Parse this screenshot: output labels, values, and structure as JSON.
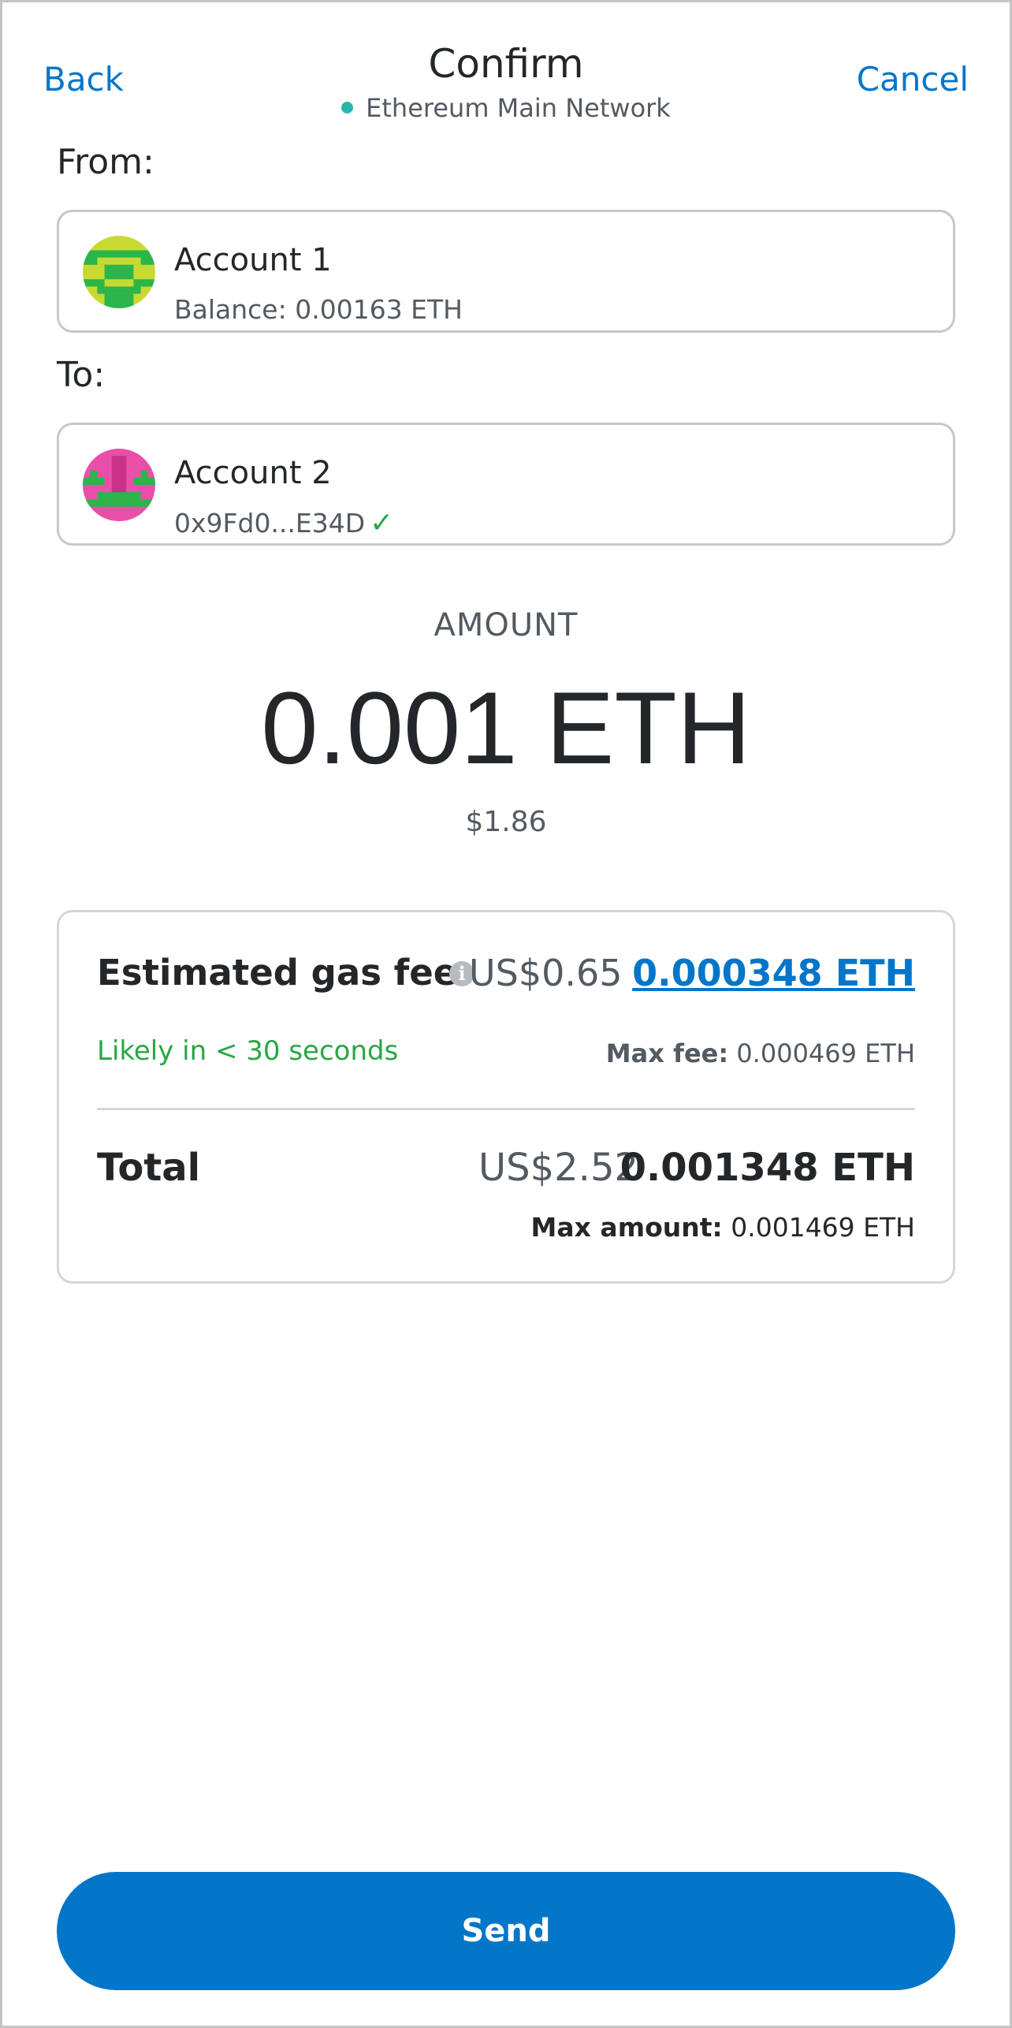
{
  "header": {
    "back_label": "Back",
    "title": "Confirm",
    "network": "Ethereum Main Network",
    "cancel_label": "Cancel"
  },
  "from": {
    "label": "From:",
    "account_name": "Account 1",
    "balance": "Balance: 0.00163 ETH"
  },
  "to": {
    "label": "To:",
    "account_name": "Account 2",
    "address": "0x9Fd0...E34D",
    "verified_icon": "check-icon"
  },
  "amount": {
    "label": "AMOUNT",
    "value": "0.001 ETH",
    "fiat": "$1.86"
  },
  "gas": {
    "title": "Estimated gas fee",
    "info_icon": "info-icon",
    "fiat": "US$0.65",
    "eth": "0.000348 ETH",
    "likely": "Likely in < 30 seconds",
    "max_fee_label": "Max fee:",
    "max_fee_value": "0.000469 ETH"
  },
  "total": {
    "label": "Total",
    "fiat": "US$2.52",
    "eth": "0.001348 ETH",
    "max_amount_label": "Max amount:",
    "max_amount_value": "0.001469 ETH"
  },
  "send_label": "Send",
  "colors": {
    "accent": "#0376c9",
    "success": "#28a745",
    "network_dot": "#29b6af"
  }
}
